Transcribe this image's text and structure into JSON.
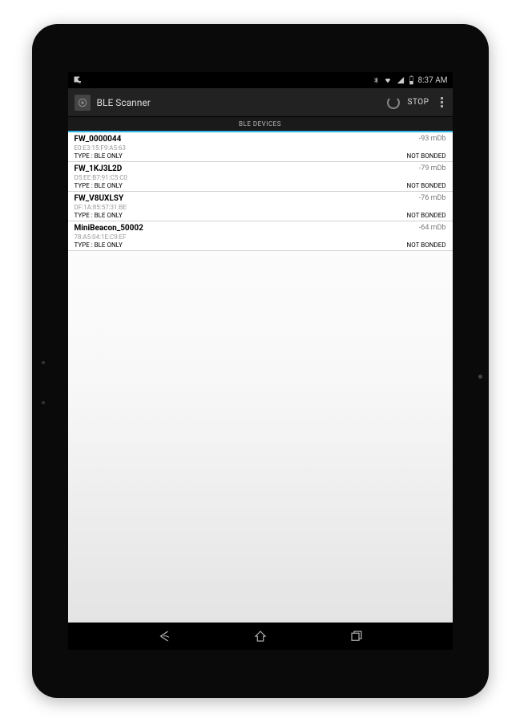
{
  "status": {
    "time": "8:37 AM"
  },
  "actionbar": {
    "title": "BLE Scanner",
    "stop_label": "STOP"
  },
  "section_header": "BLE DEVICES",
  "devices": [
    {
      "name": "FW_0000044",
      "mac": "E0:E3:15:F9:A5:63",
      "type": "TYPE : BLE ONLY",
      "signal": "-93 mDb",
      "bond": "NOT BONDED"
    },
    {
      "name": "FW_1KJ3L2D",
      "mac": "D5:EE:B7:91:C5:C0",
      "type": "TYPE : BLE ONLY",
      "signal": "-79 mDb",
      "bond": "NOT BONDED"
    },
    {
      "name": "FW_V8UXLSY",
      "mac": "DF:1A:85:57:31:BE",
      "type": "TYPE : BLE ONLY",
      "signal": "-76 mDb",
      "bond": "NOT BONDED"
    },
    {
      "name": "MiniBeacon_50002",
      "mac": "78:A5:04:1E:C9:EF",
      "type": "TYPE : BLE ONLY",
      "signal": "-64 mDb",
      "bond": "NOT BONDED"
    }
  ]
}
